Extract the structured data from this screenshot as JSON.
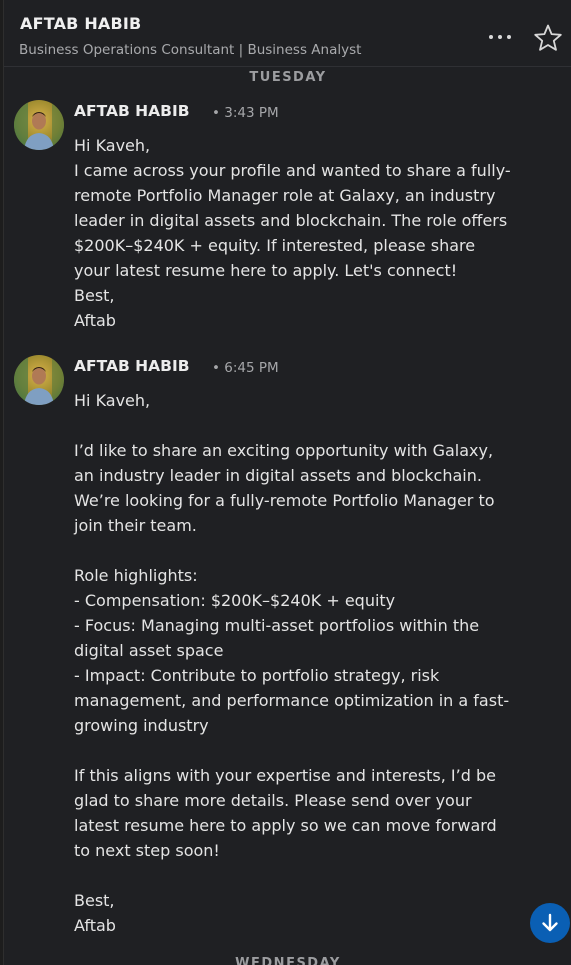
{
  "header": {
    "name": "AFTAB HABIB",
    "headline": "Business Operations Consultant | Business Analyst",
    "more_icon": "more-horizontal-icon",
    "star_icon": "star-icon"
  },
  "dividers": {
    "tuesday": "TUESDAY",
    "wednesday": "WEDNESDAY"
  },
  "messages": [
    {
      "sender": "AFTAB HABIB",
      "time": "• 3:43 PM",
      "body": "Hi Kaveh,\nI came across your profile and wanted to share a fully-remote Portfolio Manager role at Galaxy, an industry leader in digital assets and blockchain. The role offers $200K–$240K + equity. If interested, please share your latest resume here to apply. Let's connect!\nBest,\nAftab"
    },
    {
      "sender": "AFTAB HABIB",
      "time": "• 6:45 PM",
      "body": "Hi Kaveh,\n\nI’d like to share an exciting opportunity with Galaxy, an industry leader in digital assets and blockchain. We’re looking for a fully-remote Portfolio Manager to join their team.\n\nRole highlights:\n- Compensation: $200K–$240K + equity\n- Focus: Managing multi-asset portfolios within the digital asset space\n- Impact: Contribute to portfolio strategy, risk management, and performance optimization in a fast-growing industry\n\nIf this aligns with your expertise and interests, I’d be glad to share more details. Please send over your latest resume here to apply so we can move forward to next step soon!\n\nBest,\nAftab"
    }
  ],
  "scroll_button_icon": "arrow-down-icon",
  "colors": {
    "background": "#1f2023",
    "accent": "#0a5fb4"
  }
}
